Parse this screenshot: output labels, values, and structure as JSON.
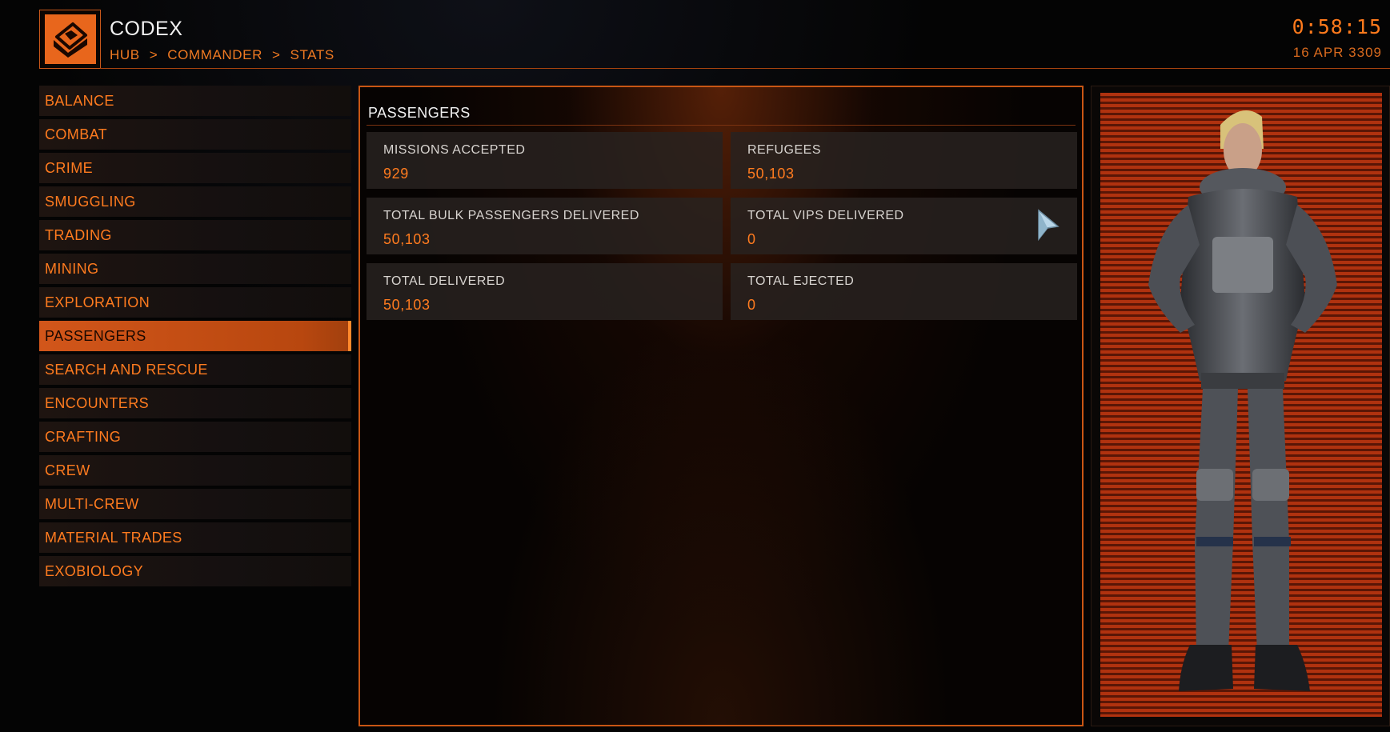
{
  "header": {
    "title": "CODEX",
    "breadcrumb": [
      "HUB",
      ">",
      "COMMANDER",
      ">",
      "STATS"
    ],
    "clock": "0:58:15",
    "date": "16 APR 3309",
    "logo_icon": "codex-book-icon"
  },
  "sidebar": {
    "items": [
      {
        "label": "BALANCE",
        "active": false
      },
      {
        "label": "COMBAT",
        "active": false
      },
      {
        "label": "CRIME",
        "active": false
      },
      {
        "label": "SMUGGLING",
        "active": false
      },
      {
        "label": "TRADING",
        "active": false
      },
      {
        "label": "MINING",
        "active": false
      },
      {
        "label": "EXPLORATION",
        "active": false
      },
      {
        "label": "PASSENGERS",
        "active": true
      },
      {
        "label": "SEARCH AND RESCUE",
        "active": false
      },
      {
        "label": "ENCOUNTERS",
        "active": false
      },
      {
        "label": "CRAFTING",
        "active": false
      },
      {
        "label": "CREW",
        "active": false
      },
      {
        "label": "MULTI-CREW",
        "active": false
      },
      {
        "label": "MATERIAL TRADES",
        "active": false
      },
      {
        "label": "EXOBIOLOGY",
        "active": false
      }
    ]
  },
  "main": {
    "title": "PASSENGERS",
    "stats": [
      {
        "label": "MISSIONS ACCEPTED",
        "value": "929"
      },
      {
        "label": "REFUGEES",
        "value": "50,103"
      },
      {
        "label": "TOTAL BULK PASSENGERS DELIVERED",
        "value": "50,103"
      },
      {
        "label": "TOTAL VIPS DELIVERED",
        "value": "0"
      },
      {
        "label": "TOTAL DELIVERED",
        "value": "50,103"
      },
      {
        "label": "TOTAL EJECTED",
        "value": "0"
      }
    ]
  },
  "portrait": {
    "icon": "commander-avatar"
  },
  "colors": {
    "accent": "#ff7b1f",
    "active_bg": "#c9521a",
    "panel_border": "#c85614",
    "portrait_stripe": "#b0320f"
  }
}
